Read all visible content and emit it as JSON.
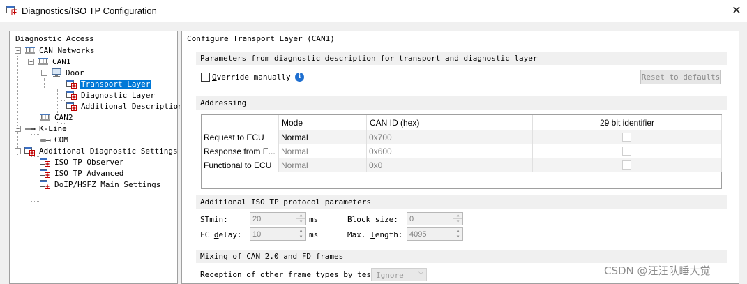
{
  "window": {
    "title": "Diagnostics/ISO TP Configuration",
    "close_icon": "close-icon"
  },
  "left_panel": {
    "header": "Diagnostic Access",
    "tree": [
      {
        "label": "CAN Networks",
        "icon": "network-icon",
        "expanded": true
      },
      {
        "label": "CAN1",
        "icon": "network-icon",
        "expanded": true
      },
      {
        "label": "Door",
        "icon": "ecu-computer-icon",
        "expanded": true
      },
      {
        "label": "Transport Layer",
        "icon": "settings-page-icon",
        "selected": true
      },
      {
        "label": "Diagnostic Layer",
        "icon": "settings-page-icon"
      },
      {
        "label": "Additional Descriptions",
        "icon": "settings-page-icon"
      },
      {
        "label": "CAN2",
        "icon": "network-icon"
      },
      {
        "label": "K-Line",
        "icon": "cable-icon",
        "expanded": true
      },
      {
        "label": "COM",
        "icon": "cable-icon"
      },
      {
        "label": "Additional Diagnostic Settings",
        "icon": "settings-page-icon",
        "expanded": true
      },
      {
        "label": "ISO TP Observer",
        "icon": "settings-page-icon"
      },
      {
        "label": "ISO TP Advanced",
        "icon": "settings-page-icon"
      },
      {
        "label": "DoIP/HSFZ Main Settings",
        "icon": "settings-page-icon"
      }
    ]
  },
  "right_panel": {
    "header": "Configure Transport Layer (CAN1)",
    "params_section": {
      "title": "Parameters from diagnostic description for transport and diagnostic layer",
      "override_label": "Override manually",
      "override_checked": false,
      "reset_button": "Reset to defaults"
    },
    "addressing": {
      "title": "Addressing",
      "columns": [
        "",
        "Mode",
        "CAN ID (hex)",
        "29 bit identifier"
      ],
      "rows": [
        {
          "name": "Request to ECU",
          "mode": "Normal",
          "can_id": "0x700",
          "bit29": false
        },
        {
          "name": "Response from E...",
          "mode": "Normal",
          "can_id": "0x600",
          "bit29": false
        },
        {
          "name": "Functional to ECU",
          "mode": "Normal",
          "can_id": "0x0",
          "bit29": false
        }
      ]
    },
    "iso_tp": {
      "title": "Additional ISO TP protocol parameters",
      "stmin_label": "STmin:",
      "stmin_value": "20",
      "stmin_unit": "ms",
      "fc_delay_label": "FC delay:",
      "fc_delay_value": "10",
      "fc_delay_unit": "ms",
      "block_size_label": "Block size:",
      "block_size_value": "0",
      "max_length_label": "Max. length:",
      "max_length_value": "4095"
    },
    "mixing": {
      "title": "Mixing of CAN 2.0 and FD frames",
      "reception_label": "Reception of other frame types by tester:",
      "reception_value": "Ignore"
    }
  },
  "watermark": "CSDN @汪汪队睡大觉",
  "colors": {
    "selection": "#0078d7",
    "section_header_bg": "#f0f0f0",
    "info_icon": "#1f6fd0"
  }
}
